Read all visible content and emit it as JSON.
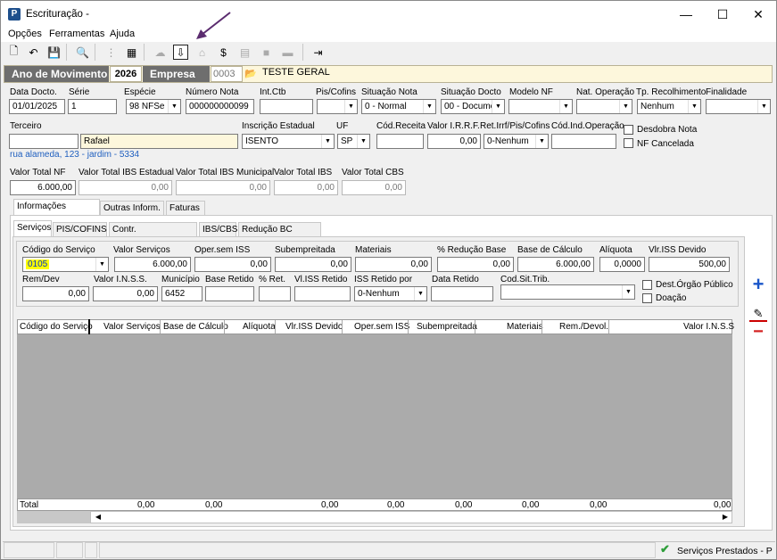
{
  "window": {
    "title": "Escrituração -",
    "minimize": "—",
    "maximize": "☐",
    "close": "✕"
  },
  "menu": [
    "Opções",
    "Ferramentas",
    "Ajuda"
  ],
  "colors": {
    "accent": "#1e4f8c",
    "annotation_arrow": "#5b2c6f",
    "header_bg": "#fdf7dc"
  },
  "header": {
    "ano_label": "Ano de Movimento",
    "ano_value": "2026",
    "empresa_label": "Empresa",
    "empresa_code": "0003",
    "empresa_name": "TESTE GERAL"
  },
  "row1": {
    "labels": [
      "Data Docto.",
      "Série",
      "Espécie",
      "Número Nota",
      "Int.Ctb",
      "Pis/Cofins",
      "Situação Nota",
      "Situação Docto",
      "Modelo NF",
      "Nat. Operação",
      "Tp. Recolhimento",
      "Finalidade"
    ],
    "data_docto": "01/01/2025",
    "serie": "1",
    "especie": "98 NFSe",
    "numero_nota": "000000000099",
    "int_ctb": "",
    "pis_cofins": "",
    "situacao_nota": "0 - Normal",
    "situacao_docto": "00 - Documer",
    "modelo_nf": "",
    "nat_operacao": "",
    "tp_recolhimento": "Nenhum",
    "finalidade": ""
  },
  "row2": {
    "labels": [
      "Terceiro",
      "Inscrição Estadual",
      "UF",
      "Cód.Receita",
      "Valor I.R.R.F.",
      "Ret.Irrf/Pis/Cofins",
      "Cód.Ind.Operação"
    ],
    "terceiro_code": "",
    "terceiro_name": "Rafael",
    "inscricao": "ISENTO",
    "uf": "SP",
    "cod_receita": "",
    "valor_irrf": "0,00",
    "ret_irrf": "0-Nenhum",
    "cod_ind_op": "",
    "address": "rua alameda, 123 - jardim - 5334",
    "desdobra_nota": "Desdobra Nota",
    "nf_cancelada": "NF Cancelada"
  },
  "totals": {
    "labels": [
      "Valor Total NF",
      "Valor Total IBS Estadual",
      "Valor Total IBS Municipal",
      "Valor Total IBS",
      "Valor Total CBS"
    ],
    "values": [
      "6.000,00",
      "0,00",
      "0,00",
      "0,00",
      "0,00"
    ]
  },
  "outer_tabs": [
    "Informações Serviços",
    "Outras Inform.",
    "Faturas"
  ],
  "inner_tabs": [
    "Serviços",
    "PIS/COFINS",
    "Contr. Previdenciária",
    "IBS/CBS",
    "Redução BC IBS/CBS"
  ],
  "service": {
    "labels1": [
      "Código do Serviço",
      "Valor Serviços",
      "Oper.sem ISS",
      "Subempreitada",
      "Materiais",
      "% Redução Base",
      "Base de Cálculo",
      "Alíquota",
      "Vlr.ISS Devido"
    ],
    "codigo": "0105",
    "valor_servicos": "6.000,00",
    "oper_sem_iss": "0,00",
    "subempreitada": "0,00",
    "materiais": "0,00",
    "pct_reducao": "0,00",
    "base_calculo": "6.000,00",
    "aliquota": "0,0000",
    "vlr_iss_devido": "500,00",
    "labels2": [
      "Rem/Dev",
      "Valor I.N.S.S.",
      "Município",
      "Base Retido",
      "% Ret.",
      "Vl.ISS Retido",
      "ISS Retido por",
      "Data Retido",
      "Cod.Sit.Trib."
    ],
    "rem_dev": "0,00",
    "valor_inss": "0,00",
    "municipio": "6452",
    "base_retido": "",
    "pct_ret": "",
    "vl_iss_retido": "",
    "iss_retido_por": "0-Nenhum",
    "data_retido": "",
    "cod_sit_trib": "",
    "dest_orgao": "Dest.Órgão Público",
    "doacao": "Doação"
  },
  "grid": {
    "columns": [
      "Código do Serviço",
      "Valor Serviços",
      "Base de Cálculo",
      "Alíquota",
      "Vlr.ISS Devido",
      "Oper.sem ISS",
      "Subempreitada",
      "Materiais",
      "Rem./Devol.",
      "Valor I.N.S.S"
    ],
    "total_label": "Total",
    "totals": [
      "0,00",
      "0,00",
      "0,00",
      "0,00",
      "0,00",
      "0,00",
      "0,00",
      "0,00"
    ]
  },
  "status": {
    "text": "Serviços Prestados - P"
  }
}
